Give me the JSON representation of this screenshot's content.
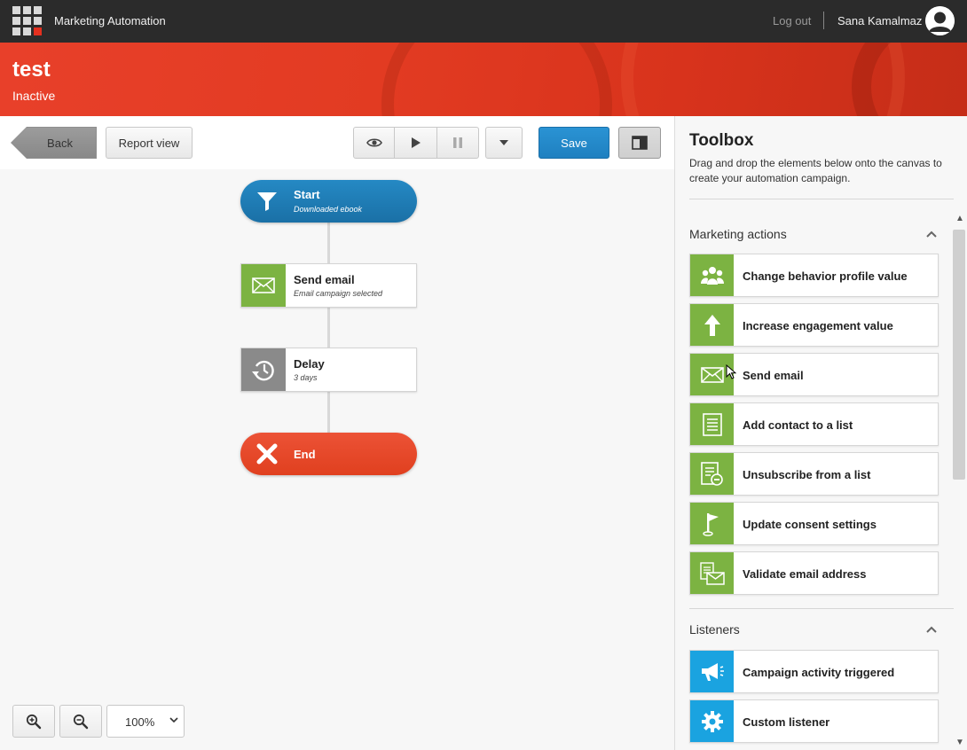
{
  "topbar": {
    "app_title": "Marketing Automation",
    "logout_label": "Log out",
    "user_name": "Sana Kamalmaz"
  },
  "header": {
    "title": "test",
    "status": "Inactive"
  },
  "toolbar": {
    "back_label": "Back",
    "report_view_label": "Report view",
    "save_label": "Save"
  },
  "flow": {
    "start": {
      "title": "Start",
      "subtitle": "Downloaded ebook"
    },
    "send_email": {
      "title": "Send email",
      "subtitle": "Email campaign selected"
    },
    "delay": {
      "title": "Delay",
      "subtitle": "3 days"
    },
    "end": {
      "title": "End"
    }
  },
  "zoom": {
    "value": "100%"
  },
  "toolbox": {
    "title": "Toolbox",
    "description": "Drag and drop the elements below onto the canvas to create your automation campaign.",
    "sections": {
      "marketing_actions": {
        "title": "Marketing actions",
        "items": [
          {
            "label": "Change behavior profile value",
            "icon": "people-icon"
          },
          {
            "label": "Increase engagement value",
            "icon": "arrow-up-icon"
          },
          {
            "label": "Send email",
            "icon": "envelope-icon"
          },
          {
            "label": "Add contact to a list",
            "icon": "list-icon"
          },
          {
            "label": "Unsubscribe from a list",
            "icon": "list-remove-icon"
          },
          {
            "label": "Update consent settings",
            "icon": "flag-icon"
          },
          {
            "label": "Validate email address",
            "icon": "validate-email-icon"
          }
        ]
      },
      "listeners": {
        "title": "Listeners",
        "items": [
          {
            "label": "Campaign activity triggered",
            "icon": "megaphone-icon"
          },
          {
            "label": "Custom listener",
            "icon": "gear-icon"
          }
        ]
      }
    }
  },
  "colors": {
    "topbar": "#2b2b2b",
    "header_red": "#e23b22",
    "start_blue": "#1e7db5",
    "end_red": "#e8472c",
    "action_green": "#7cb342",
    "delay_gray": "#8a8a8a",
    "listener_blue": "#1aa3e0",
    "save_blue": "#2289c9"
  }
}
